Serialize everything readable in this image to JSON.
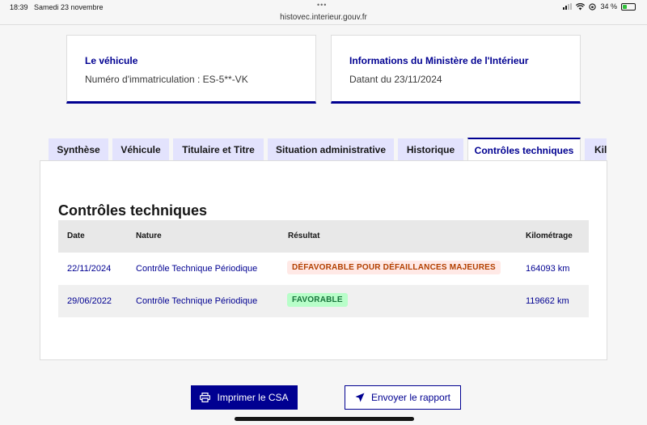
{
  "statusbar": {
    "time": "18:39",
    "date": "Samedi 23 novembre",
    "dots": "•••",
    "battery": "34 %",
    "battery_level": 0.34,
    "url": "histovec.interieur.gouv.fr"
  },
  "cards": {
    "vehicle": {
      "title": "Le véhicule",
      "text": "Numéro d'immatriculation : ES-5**-VK"
    },
    "ministry": {
      "title": "Informations du Ministère de l'Intérieur",
      "text": "Datant du 23/11/2024"
    }
  },
  "tabs": [
    {
      "label": "Synthèse"
    },
    {
      "label": "Véhicule"
    },
    {
      "label": "Titulaire et Titre"
    },
    {
      "label": "Situation administrative"
    },
    {
      "label": "Historique"
    },
    {
      "label": "Contrôles techniques",
      "active": true
    },
    {
      "label": "Kilo"
    }
  ],
  "main": {
    "title": "Contrôles techniques",
    "columns": [
      "Date",
      "Nature",
      "Résultat",
      "Kilométrage"
    ],
    "rows": [
      {
        "date": "22/11/2024",
        "nature": "Contrôle Technique Périodique",
        "result": "DÉFAVORABLE POUR DÉFAILLANCES MAJEURES",
        "status": "defavorable",
        "km": "164093 km"
      },
      {
        "date": "29/06/2022",
        "nature": "Contrôle Technique Périodique",
        "result": "FAVORABLE",
        "status": "favorable",
        "km": "119662 km"
      }
    ]
  },
  "actions": {
    "print_label": "Imprimer le CSA",
    "send_label": "Envoyer le rapport"
  },
  "colors": {
    "primary": "#000091",
    "error_bg": "#ffe9e6",
    "error_text": "#b34000",
    "success_bg": "#b8fec9",
    "success_text": "#18753c"
  }
}
